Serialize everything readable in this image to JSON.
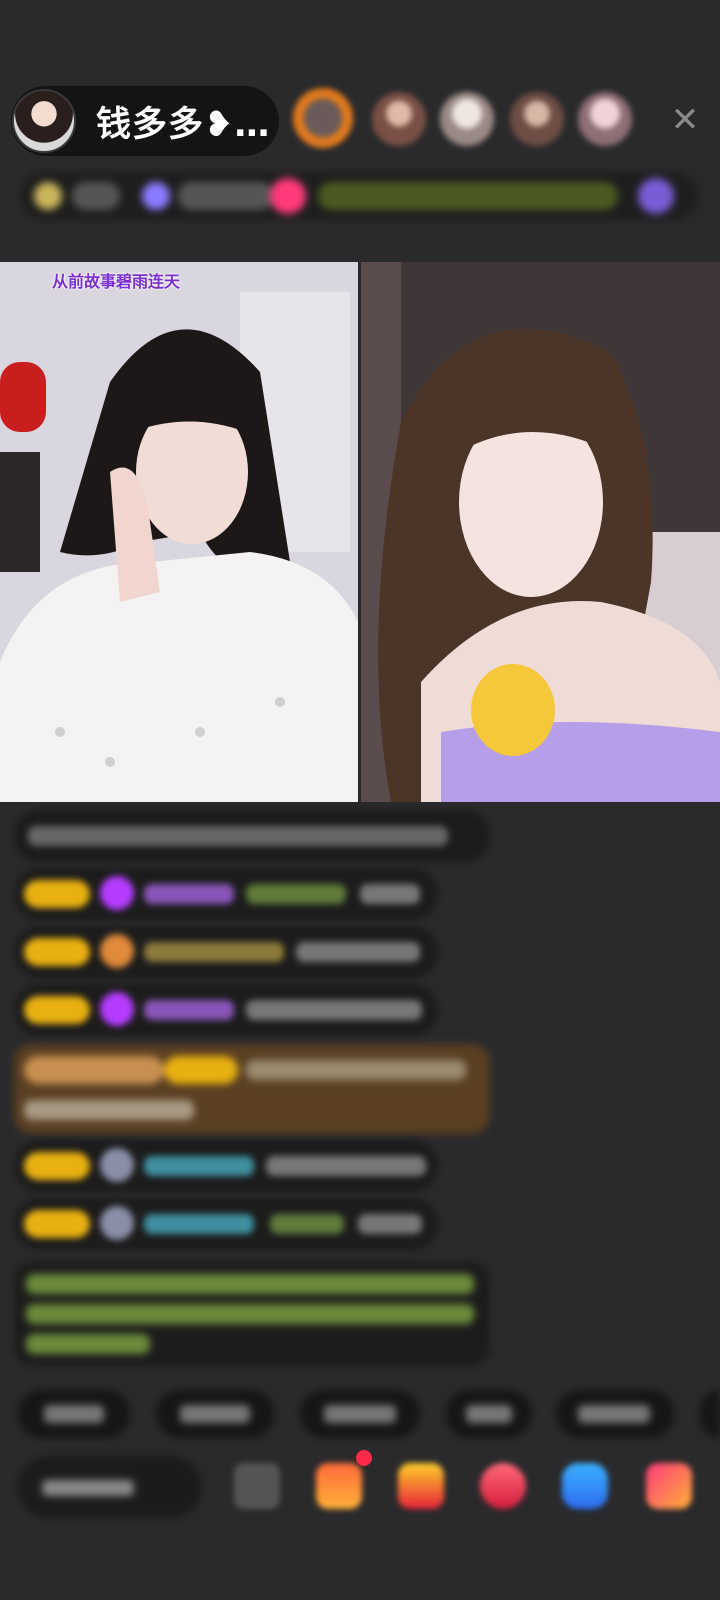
{
  "header": {
    "host_name": "钱多多❥…",
    "close_label": "✕"
  },
  "video": {
    "left_overlay_title": "从前故事碧雨连天"
  },
  "colors": {
    "background": "#2a2a2c",
    "badge_gold": "#e8b010",
    "system_message_bg": "#5a3f22",
    "notification_dot": "#ff2a4a"
  }
}
